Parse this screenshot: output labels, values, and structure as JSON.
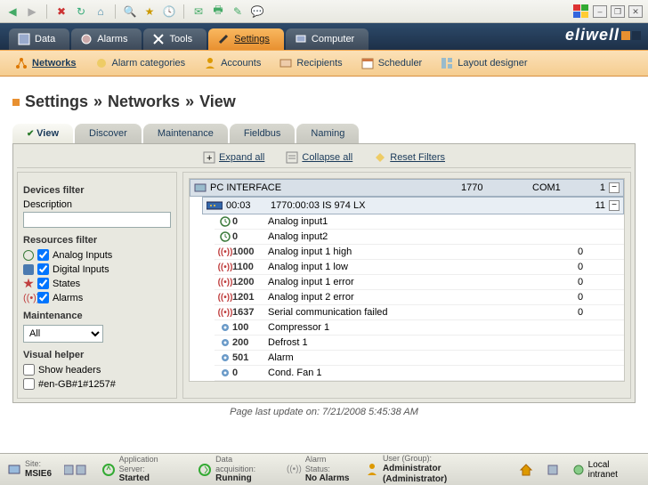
{
  "toolbar": {
    "window_buttons": [
      "–",
      "❐",
      "✕"
    ]
  },
  "maintabs": [
    "Data",
    "Alarms",
    "Tools",
    "Settings",
    "Computer"
  ],
  "maintabs_active": 3,
  "brand": "eliwell",
  "subnav": [
    "Networks",
    "Alarm categories",
    "Accounts",
    "Recipients",
    "Scheduler",
    "Layout designer"
  ],
  "subnav_active": 0,
  "breadcrumb": [
    "Settings",
    "»",
    "Networks",
    "»",
    "View"
  ],
  "innertabs": [
    "View",
    "Discover",
    "Maintenance",
    "Fieldbus",
    "Naming"
  ],
  "innertabs_active": 0,
  "actions": {
    "expand": "Expand all",
    "collapse": "Collapse all",
    "reset": "Reset Filters"
  },
  "filters": {
    "devices_title": "Devices filter",
    "desc_label": "Description",
    "resources_title": "Resources filter",
    "resources": [
      "Analog Inputs",
      "Digital Inputs",
      "States",
      "Alarms"
    ],
    "maintenance_title": "Maintenance",
    "maintenance_value": "All",
    "visual_title": "Visual helper",
    "visual": [
      "Show headers",
      "#en-GB#1#1257#"
    ]
  },
  "tree": {
    "root": {
      "name": "PC INTERFACE",
      "addr": "1770",
      "port": "COM1",
      "count": "1"
    },
    "device": {
      "time": "00:03",
      "name": "1770:00:03 IS 974 LX",
      "count": "11"
    },
    "rows": [
      {
        "icon": "clock",
        "num": "0",
        "name": "Analog input1",
        "val": ""
      },
      {
        "icon": "clock",
        "num": "0",
        "name": "Analog input2",
        "val": ""
      },
      {
        "icon": "alarm",
        "num": "1000",
        "name": "Analog input 1 high",
        "val": "0"
      },
      {
        "icon": "alarm",
        "num": "1100",
        "name": "Analog input 1 low",
        "val": "0"
      },
      {
        "icon": "alarm",
        "num": "1200",
        "name": "Analog input 1 error",
        "val": "0"
      },
      {
        "icon": "alarm",
        "num": "1201",
        "name": "Analog input 2 error",
        "val": "0"
      },
      {
        "icon": "alarm",
        "num": "1637",
        "name": "Serial communication failed",
        "val": "0"
      },
      {
        "icon": "gear",
        "num": "100",
        "name": "Compressor 1",
        "val": ""
      },
      {
        "icon": "gear",
        "num": "200",
        "name": "Defrost 1",
        "val": ""
      },
      {
        "icon": "gear",
        "num": "501",
        "name": "Alarm",
        "val": ""
      },
      {
        "icon": "gear",
        "num": "0",
        "name": "Cond. Fan 1",
        "val": ""
      }
    ]
  },
  "timestamp": "Page last update on: 7/21/2008 5:45:38 AM",
  "status": {
    "site_label": "Site:",
    "site": "MSIE6",
    "app_label": "Application Server:",
    "app": "Started",
    "data_label": "Data acquisition:",
    "data": "Running",
    "alarm_label": "Alarm Status:",
    "alarm": "No Alarms",
    "user_label": "User (Group):",
    "user": "Administrator (Administrator)",
    "zone": "Local intranet"
  }
}
